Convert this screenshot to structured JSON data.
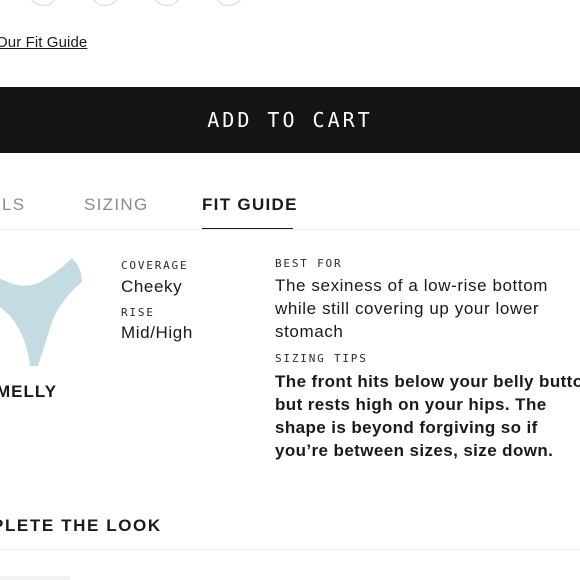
{
  "fit_guide_link": "Our Fit Guide",
  "add_to_cart": "ADD TO CART",
  "tabs": [
    {
      "label": "ILS",
      "active": false
    },
    {
      "label": "SIZING",
      "active": false
    },
    {
      "label": "FIT GUIDE",
      "active": true
    }
  ],
  "product": {
    "style_name": "MELLY",
    "garment_icon": "bikini-bottom-illustration",
    "garment_color": "#c4dbe4"
  },
  "specs": {
    "coverage_label": "COVERAGE",
    "coverage_value": "Cheeky",
    "rise_label": "RISE",
    "rise_value": "Mid/High"
  },
  "details": {
    "best_for_label": "BEST FOR",
    "best_for_text": "The sexiness of a low-rise bottom while still covering up your lower stomach",
    "sizing_tips_label": "SIZING TIPS",
    "sizing_tips_text": "The front hits below your belly button but rests high on your hips. The shape is beyond forgiving so if you’re between sizes, size down."
  },
  "complete_the_look": "PLETE THE LOOK",
  "colors": {
    "button_bg": "#141414",
    "text": "#1a1a1a",
    "inactive_tab": "#8a8a8a"
  }
}
